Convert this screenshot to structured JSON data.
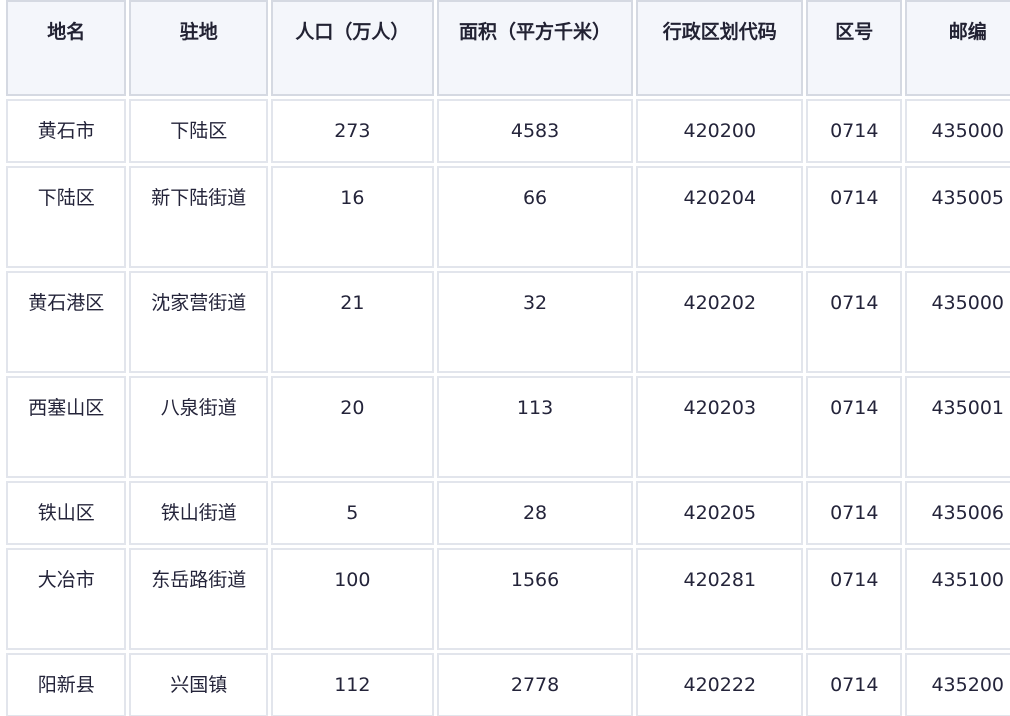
{
  "table": {
    "headers": [
      "地名",
      "驻地",
      "人口（万人）",
      "面积（平方千米）",
      "行政区划代码",
      "区号",
      "邮编"
    ],
    "rows": [
      [
        "黄石市",
        "下陆区",
        "273",
        "4583",
        "420200",
        "0714",
        "435000"
      ],
      [
        "下陆区",
        "新下陆街道",
        "16",
        "66",
        "420204",
        "0714",
        "435005"
      ],
      [
        "黄石港区",
        "沈家营街道",
        "21",
        "32",
        "420202",
        "0714",
        "435000"
      ],
      [
        "西塞山区",
        "八泉街道",
        "20",
        "113",
        "420203",
        "0714",
        "435001"
      ],
      [
        "铁山区",
        "铁山街道",
        "5",
        "28",
        "420205",
        "0714",
        "435006"
      ],
      [
        "大冶市",
        "东岳路街道",
        "100",
        "1566",
        "420281",
        "0714",
        "435100"
      ],
      [
        "阳新县",
        "兴国镇",
        "112",
        "2778",
        "420222",
        "0714",
        "435200"
      ]
    ]
  }
}
